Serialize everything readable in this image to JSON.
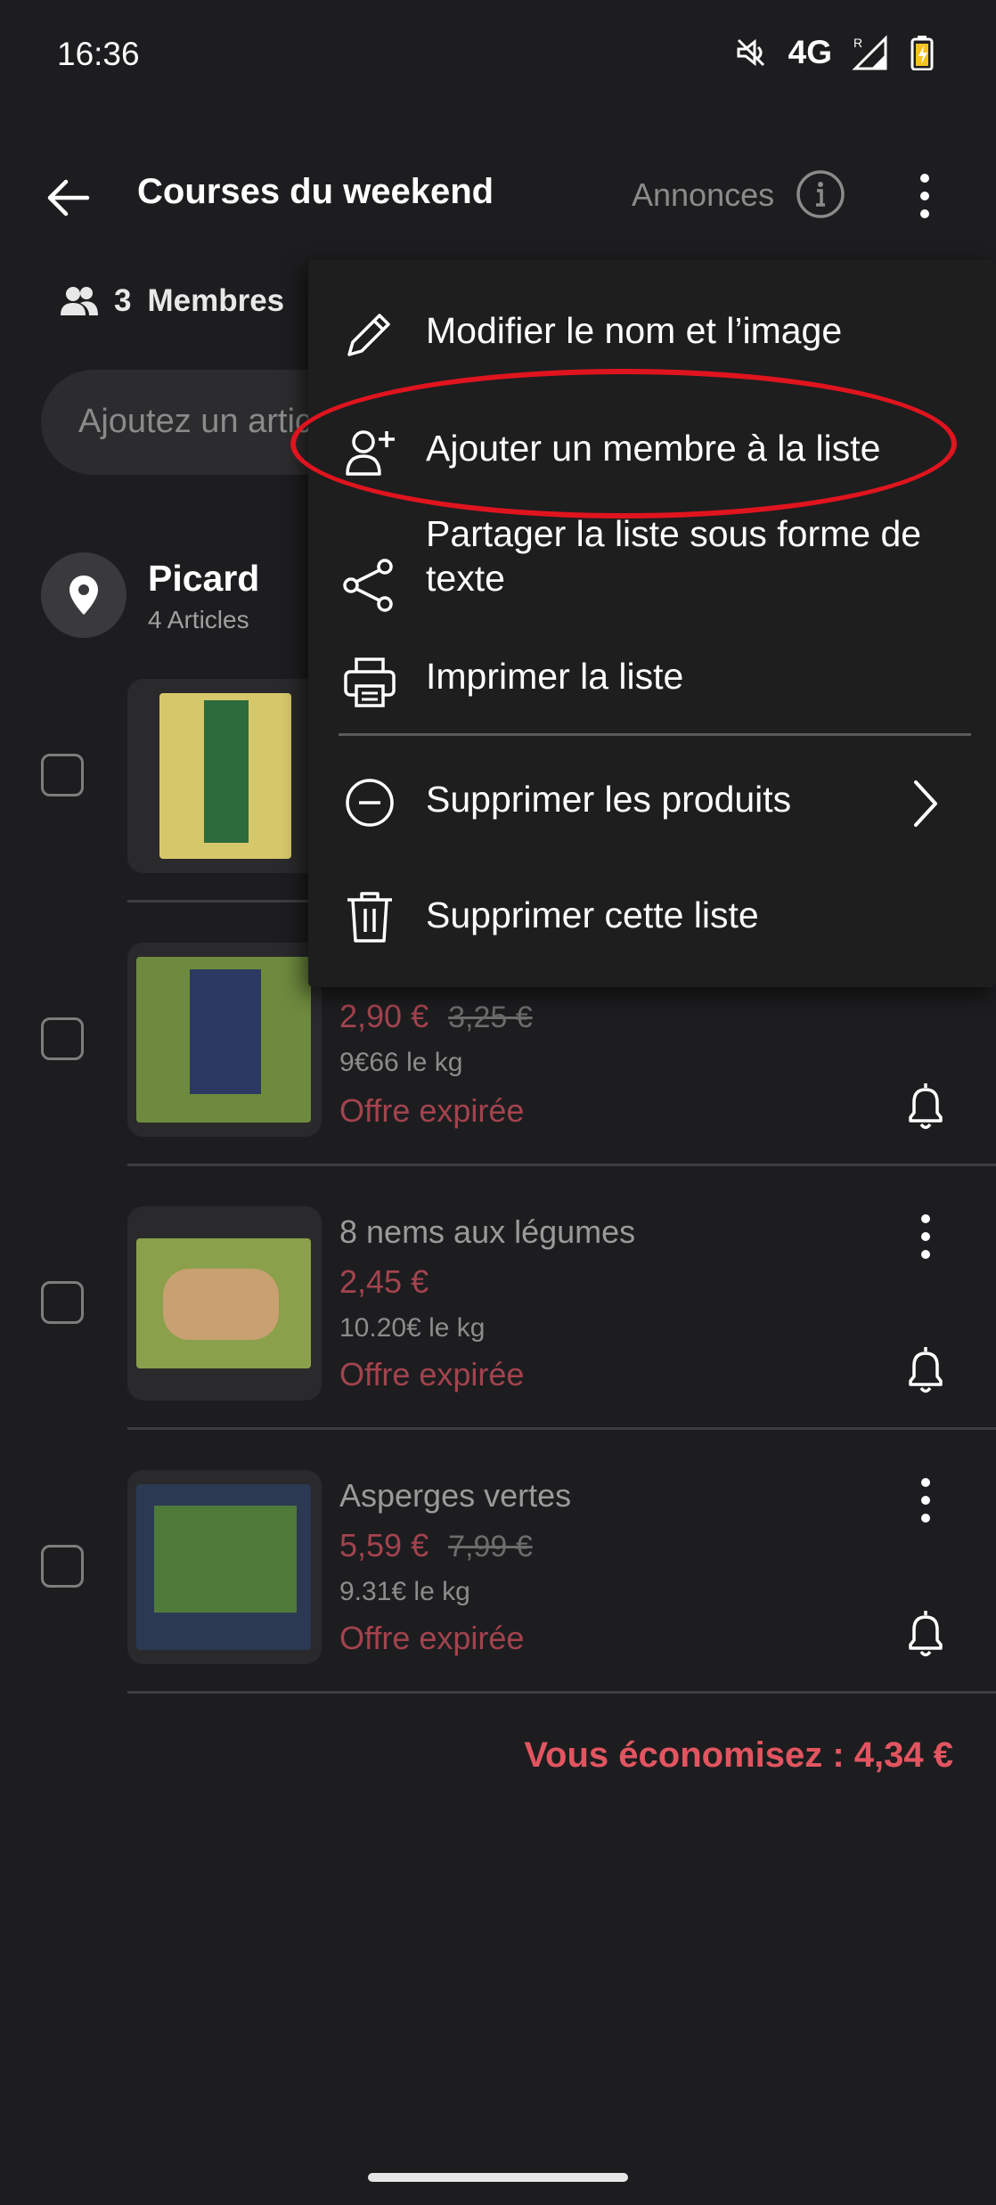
{
  "status_bar": {
    "time": "16:36",
    "network": "4G",
    "roaming": "R"
  },
  "header": {
    "title": "Courses du weekend",
    "annonces": "Annonces"
  },
  "members": {
    "count": "3",
    "label": "Membres"
  },
  "search": {
    "placeholder": "Ajoutez un article"
  },
  "store": {
    "name": "Picard",
    "count": "4 Articles"
  },
  "products": [
    {
      "name": "",
      "price": "",
      "old_price": "",
      "unit_price": "",
      "status": ""
    },
    {
      "name": "",
      "price": "2,90 €",
      "old_price": "3,25 €",
      "unit_price": "9€66 le kg",
      "status": "Offre expirée"
    },
    {
      "name": "8 nems aux légumes",
      "price": "2,45 €",
      "old_price": "",
      "unit_price": "10.20€ le kg",
      "status": "Offre expirée"
    },
    {
      "name": "Asperges vertes",
      "price": "5,59 €",
      "old_price": "7,99 €",
      "unit_price": "9.31€ le kg",
      "status": "Offre expirée"
    }
  ],
  "footer": {
    "savings": "Vous économisez : 4,34 €"
  },
  "menu": {
    "items": [
      {
        "label": "Modifier le nom et l’image",
        "icon": "pencil-icon"
      },
      {
        "label": "Ajouter un membre à la liste",
        "icon": "add-member-icon"
      },
      {
        "label": "Partager la liste sous forme de texte",
        "icon": "share-icon"
      },
      {
        "label": "Imprimer la liste",
        "icon": "printer-icon"
      },
      {
        "label": "Supprimer les produits",
        "icon": "minus-circle-icon"
      },
      {
        "label": "Supprimer cette liste",
        "icon": "trash-icon"
      }
    ]
  },
  "colors": {
    "background": "#1d1d1f",
    "price_red": "#a3434e",
    "savings_red": "#e25560",
    "highlight": "#e0141e"
  }
}
